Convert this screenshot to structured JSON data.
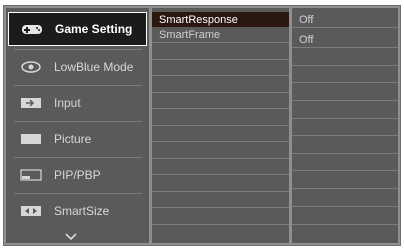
{
  "menu": [
    {
      "label": "Game Setting",
      "icon": "gamepad-icon",
      "selected": true
    },
    {
      "label": "LowBlue Mode",
      "icon": "eye-icon",
      "selected": false
    },
    {
      "label": "Input",
      "icon": "input-icon",
      "selected": false
    },
    {
      "label": "Picture",
      "icon": "picture-icon",
      "selected": false
    },
    {
      "label": "PIP/PBP",
      "icon": "pip-icon",
      "selected": false
    },
    {
      "label": "SmartSize",
      "icon": "smartsize-icon",
      "selected": false
    }
  ],
  "more_icon": "chevron-down-icon",
  "submenu": [
    {
      "label": "SmartResponse",
      "selected": true
    },
    {
      "label": "SmartFrame",
      "selected": false
    }
  ],
  "values": [
    {
      "value": "Off"
    },
    {
      "value": "Off"
    }
  ],
  "colors": {
    "panel": "#5a5a5a",
    "frame": "#8f8f8f",
    "selected_bg": "#1b1b1b",
    "submenu_selected_bg": "#2a1710",
    "text": "#d7d7d7"
  }
}
